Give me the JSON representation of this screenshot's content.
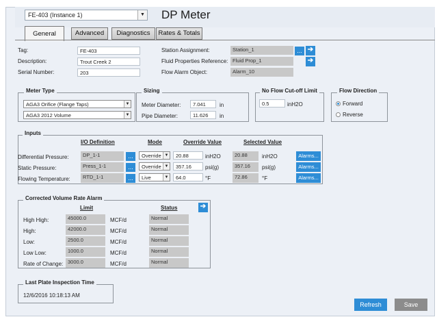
{
  "window": {
    "instance_selected": "FE-403 (Instance 1)",
    "title": "DP Meter"
  },
  "tabs": [
    {
      "label": "General",
      "active": true
    },
    {
      "label": "Advanced",
      "active": false
    },
    {
      "label": "Diagnostics",
      "active": false
    },
    {
      "label": "Rates & Totals",
      "active": false
    }
  ],
  "general": {
    "tag_label": "Tag:",
    "tag_value": "FE-403",
    "description_label": "Description:",
    "description_value": "Trout Creek 2",
    "serial_label": "Serial Number:",
    "serial_value": "203",
    "station_label": "Station Assignment:",
    "station_value": "Station_1",
    "fluid_label": "Fluid Properties Reference:",
    "fluid_value": "Fluid Prop_1",
    "flow_alarm_label": "Flow Alarm Object:",
    "flow_alarm_value": "Alarm_10",
    "browse_label": "..."
  },
  "meter_type": {
    "title": "Meter Type",
    "type_selected": "AGA3 Orifice (Flange Taps)",
    "standard_selected": "AGA3 2012 Volume"
  },
  "sizing": {
    "title": "Sizing",
    "meter_diameter_label": "Meter Diameter:",
    "meter_diameter_value": "7.041",
    "meter_diameter_unit": "in",
    "pipe_diameter_label": "Pipe Diameter:",
    "pipe_diameter_value": "11.626",
    "pipe_diameter_unit": "in"
  },
  "no_flow": {
    "title": "No Flow Cut-off Limit",
    "value": "0.5",
    "unit": "inH2O"
  },
  "flow_direction": {
    "title": "Flow Direction",
    "options": [
      "Forward",
      "Reverse"
    ],
    "selected": "Forward"
  },
  "inputs": {
    "title": "Inputs",
    "col_io": "I/O Definition",
    "col_mode": "Mode",
    "col_override": "Override Value",
    "col_selected": "Selected Value",
    "alarms_label": "Alarms...",
    "rows": [
      {
        "label": "Differential Pressure:",
        "io": "DP_1-1",
        "mode": "Override",
        "override": "20.88",
        "override_unit": "inH2O",
        "selected": "20.88",
        "selected_unit": "inH2O"
      },
      {
        "label": "Static Pressure:",
        "io": "Press_1-1",
        "mode": "Override",
        "override": "357.16",
        "override_unit": "psi(g)",
        "selected": "357.16",
        "selected_unit": "psi(g)"
      },
      {
        "label": "Flowing Temperature:",
        "io": "RTD_1-1",
        "mode": "Live",
        "override": "64.0",
        "override_unit": "°F",
        "selected": "72.86",
        "selected_unit": "°F"
      }
    ]
  },
  "alarm": {
    "title": "Corrected Volume Rate Alarm",
    "col_limit": "Limit",
    "col_status": "Status",
    "rows": [
      {
        "label": "High High:",
        "limit": "45000.0",
        "unit": "MCF/d",
        "status": "Normal"
      },
      {
        "label": "High:",
        "limit": "42000.0",
        "unit": "MCF/d",
        "status": "Normal"
      },
      {
        "label": "Low:",
        "limit": "2500.0",
        "unit": "MCF/d",
        "status": "Normal"
      },
      {
        "label": "Low Low:",
        "limit": "1000.0",
        "unit": "MCF/d",
        "status": "Normal"
      },
      {
        "label": "Rate of Change:",
        "limit": "3000.0",
        "unit": "MCF/d",
        "status": "Normal"
      }
    ]
  },
  "inspection": {
    "title": "Last Plate Inspection Time",
    "value": "12/6/2016 10:18:13 AM"
  },
  "actions": {
    "refresh_label": "Refresh",
    "save_label": "Save"
  },
  "colors": {
    "accent": "#2e8dd6",
    "readonly_bg": "#c8c8c8",
    "panel_bg": "#ecf0f6"
  }
}
